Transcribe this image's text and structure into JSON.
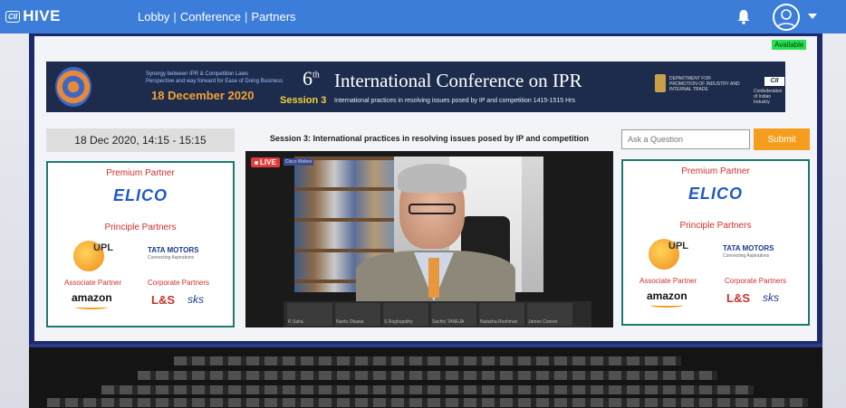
{
  "header": {
    "logo_badge": "CII",
    "logo_text": "HIVE",
    "nav": [
      "Lobby",
      "Conference",
      "Partners"
    ],
    "nav_separator": "|"
  },
  "status": {
    "availability": "Available"
  },
  "banner": {
    "tagline_1": "Synergy between IPR & Competition Laws",
    "tagline_2": "Perspective and way forward for Ease of Doing Business",
    "date": "18 December 2020",
    "edition_number": "6",
    "edition_suffix": "th",
    "title": "International Conference on IPR",
    "session": "Session 3",
    "subtitle": "International practices in resolving issues posed by IP and competition 1415-1515 Hrs",
    "gov_line_1": "DEPARTMENT FOR",
    "gov_line_2": "PROMOTION OF INDUSTRY AND",
    "gov_line_3": "INTERNAL TRADE",
    "cii_logo": "CII",
    "cii_sub": "Confederation of Indian Industry"
  },
  "schedule": {
    "datetime": "18 Dec 2020, 14:15 - 15:15"
  },
  "session_title": "Session 3: International practices in resolving issues posed by IP and competition",
  "question": {
    "placeholder": "Ask a Question",
    "submit_label": "Submit"
  },
  "video": {
    "live_label": "LIVE",
    "app_label": "Cisco Webex",
    "participants": [
      "R Saha",
      "Naoto Okawa",
      "S Raghupathy",
      "Sachin TANEJA",
      "Natasha Roshman",
      "James Conner"
    ]
  },
  "partners": {
    "premium_heading": "Premium Partner",
    "premium_logo": "ELICO",
    "principle_heading": "Principle Partners",
    "upl_logo": "UPL",
    "tata_logo": "TATA MOTORS",
    "tata_tagline": "Connecting Aspirations",
    "associate_heading": "Associate Partner",
    "associate_logo": "amazon",
    "corporate_heading": "Corporate Partners",
    "lt_logo": "L&S",
    "sks_logo": "sks"
  }
}
